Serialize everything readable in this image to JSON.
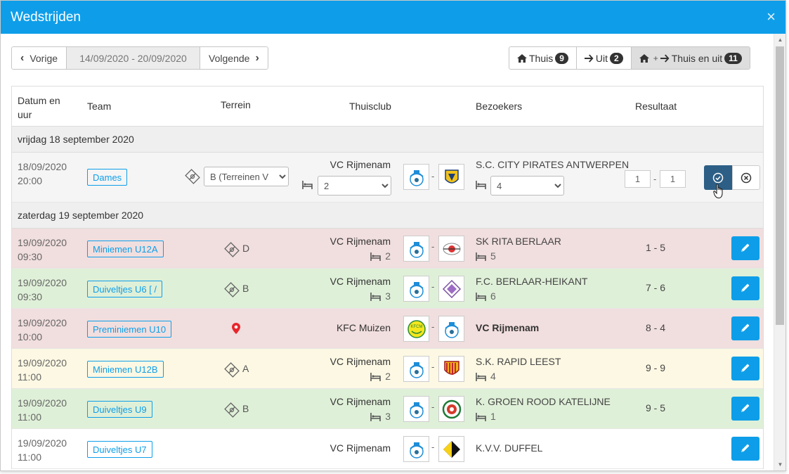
{
  "window": {
    "title": "Wedstrijden",
    "close_label": "×"
  },
  "nav": {
    "prev_label": "Vorige",
    "date_range": "14/09/2020 - 20/09/2020",
    "next_label": "Volgende"
  },
  "filters": [
    {
      "icon": "home-icon",
      "label": "Thuis",
      "count": "9"
    },
    {
      "icon": "arrow-right-icon",
      "label": "Uit",
      "count": "2"
    },
    {
      "icon": "home-plus-arrow-icon",
      "label": "Thuis en uit",
      "count": "11",
      "active": true
    }
  ],
  "filter_home_glyph": "+",
  "columns": {
    "datum": "Datum en uur",
    "team": "Team",
    "terrein": "Terrein",
    "thuisclub": "Thuisclub",
    "bezoekers": "Bezoekers",
    "resultaat": "Resultaat"
  },
  "groups": [
    {
      "label": "vrijdag 18 september 2020"
    },
    {
      "label": "zaterdag 19 september 2020"
    }
  ],
  "editing_row": {
    "date": "18/09/2020",
    "time": "20:00",
    "team": "Dames",
    "terrain_value": "B (Terreinen V",
    "home": "VC Rijmenam",
    "home_room_value": "2",
    "away": "S.C. CITY PIRATES ANTWERPEN",
    "away_room_value": "4",
    "score_home": "1",
    "score_away": "1",
    "score_sep": "-",
    "vs": "-"
  },
  "rows": [
    {
      "status": "r-red",
      "date": "19/09/2020",
      "time": "09:30",
      "team": "Miniemen U12A",
      "terrain": "D",
      "home": "VC Rijmenam",
      "home_room": "2",
      "away": "SK RITA BERLAAR",
      "away_room": "5",
      "result": "1 - 5",
      "vs": "-"
    },
    {
      "status": "r-green",
      "date": "19/09/2020",
      "time": "09:30",
      "team": "Duiveltjes U6 [ /",
      "terrain": "B",
      "home": "VC Rijmenam",
      "home_room": "3",
      "away": "F.C. BERLAAR-HEIKANT",
      "away_room": "6",
      "result": "7 - 6",
      "vs": "-"
    },
    {
      "status": "r-red",
      "date": "19/09/2020",
      "time": "10:00",
      "team": "Preminiemen U10",
      "terrain": "",
      "home": "KFC Muizen",
      "home_room": "",
      "away": "VC Rijmenam",
      "away_room": "",
      "result": "8 - 4",
      "vs": "-"
    },
    {
      "status": "r-yellow",
      "date": "19/09/2020",
      "time": "11:00",
      "team": "Miniemen U12B",
      "terrain": "A",
      "home": "VC Rijmenam",
      "home_room": "2",
      "away": "S.K. RAPID LEEST",
      "away_room": "4",
      "result": "9 - 9",
      "vs": "-"
    },
    {
      "status": "r-green",
      "date": "19/09/2020",
      "time": "11:00",
      "team": "Duiveltjes U9",
      "terrain": "B",
      "home": "VC Rijmenam",
      "home_room": "3",
      "away": "K. GROEN ROOD KATELIJNE",
      "away_room": "1",
      "result": "9 - 5",
      "vs": "-"
    },
    {
      "status": "r-white",
      "date": "19/09/2020",
      "time": "11:00",
      "team": "Duiveltjes U7",
      "terrain": "",
      "home": "VC Rijmenam",
      "home_room": "",
      "away": "K.V.V. DUFFEL",
      "away_room": "",
      "result": "",
      "vs": "-"
    }
  ],
  "colors": {
    "header": "#0e9ee9",
    "confirm": "#2d5f86",
    "row_lost": "#f1dede",
    "row_won": "#dff0d8",
    "row_draw": "#fcf8e3"
  }
}
